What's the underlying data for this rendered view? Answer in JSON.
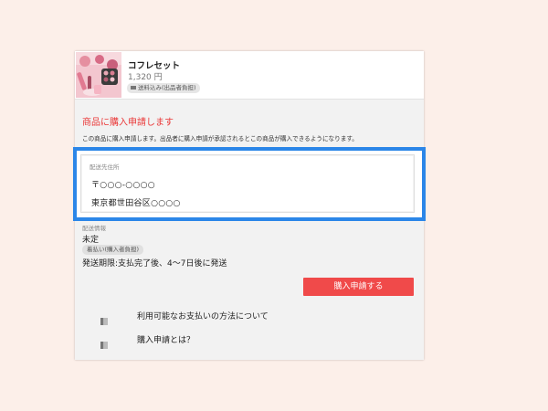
{
  "product": {
    "name": "コフレセット",
    "price": "1,320 円",
    "tag": "送料込み(出品者負担)",
    "tag_icon": "truck-icon"
  },
  "request": {
    "heading": "商品に購入申請します",
    "description": "この商品に購入申請します。出品者に購入申請が承認されるとこの商品が購入できるようになります。"
  },
  "address": {
    "label": "配送先住所",
    "zip": "〒○○○-○○○○",
    "line": "東京都世田谷区○○○○"
  },
  "shipping": {
    "label": "配送情報",
    "status": "未定",
    "tag": "着払い(購入者負担)",
    "deadline": "発送期限:支払完了後、4〜7日後に発送"
  },
  "actions": {
    "submit_label": "購入申請する"
  },
  "links": [
    {
      "label": "利用可能なお支払いの方法について",
      "icon": "book-icon"
    },
    {
      "label": "購入申請とは？",
      "icon": "book-icon"
    }
  ],
  "colors": {
    "page_bg": "#fcefe9",
    "accent_red": "#f04a4a",
    "highlight_blue": "#2b86e8"
  }
}
